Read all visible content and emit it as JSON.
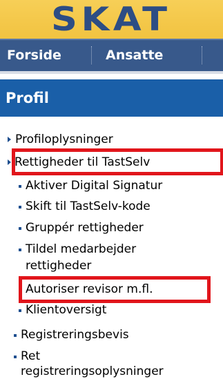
{
  "logo": {
    "text": "SKAT"
  },
  "nav": {
    "items": [
      {
        "label": "Forside"
      },
      {
        "label": "Ansatte"
      }
    ]
  },
  "section": {
    "title": "Profil"
  },
  "menu": {
    "profiloplysninger": "Profiloplysninger",
    "rettigheder": "Rettigheder til TastSelv",
    "aktiver": "Aktiver Digital Signatur",
    "skift": "Skift til TastSelv-kode",
    "grupper": "Gruppér rettigheder",
    "tildel_line1": "Tildel medarbejder",
    "tildel_line2": "rettigheder",
    "autoriser": "Autoriser revisor m.fl.",
    "klientoversigt": "Klientoversigt",
    "registreringsbevis": "Registreringsbevis",
    "ret_line1": "Ret",
    "ret_line2": "registreringsoplysninger"
  },
  "colors": {
    "logo_bg": "#f4c84a",
    "nav_bg": "#38598b",
    "section_bg": "#1a5fa8",
    "highlight": "#e1151b"
  }
}
